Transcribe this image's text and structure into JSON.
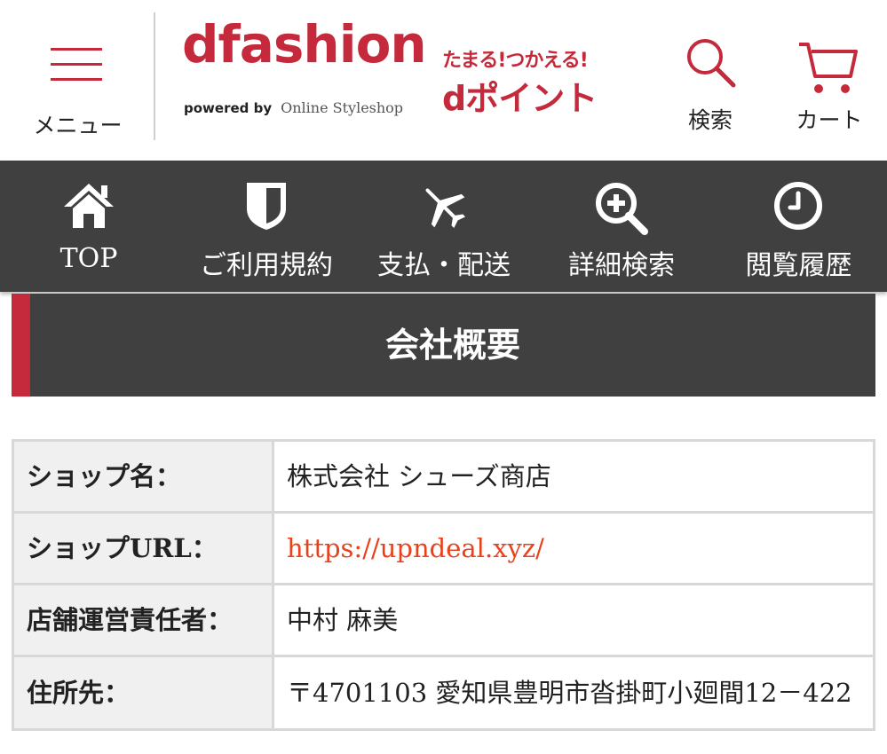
{
  "header": {
    "menu_label": "メニュー",
    "logo_main": "dfashion",
    "logo_powered": "powered by",
    "logo_oss": "Online Styleshop",
    "dpoint_tag": "たまる!つかえる!",
    "dpoint_name": "dポイント",
    "search_label": "検索",
    "cart_label": "カート"
  },
  "nav": {
    "items": [
      {
        "label": "TOP",
        "icon": "home-icon"
      },
      {
        "label": "ご利用規約",
        "icon": "shield-icon"
      },
      {
        "label": "支払・配送",
        "icon": "airplane-icon"
      },
      {
        "label": "詳細検索",
        "icon": "zoom-in-icon"
      },
      {
        "label": "閲覧履歴",
        "icon": "clock-icon"
      }
    ]
  },
  "page": {
    "title": "会社概要"
  },
  "company": {
    "rows": [
      {
        "label": "ショップ名：",
        "value": "株式会社 シューズ商店"
      },
      {
        "label": "ショップURL：",
        "value": "https://upndeal.xyz/"
      },
      {
        "label": "店舗運営責任者：",
        "value": "中村 麻美"
      },
      {
        "label": "住所先：",
        "value": "〒4701103 愛知県豊明市沓掛町小廻間12－422"
      }
    ]
  },
  "colors": {
    "brand_red": "#c42a3c",
    "nav_bg": "#404040",
    "link": "#e8421d"
  }
}
